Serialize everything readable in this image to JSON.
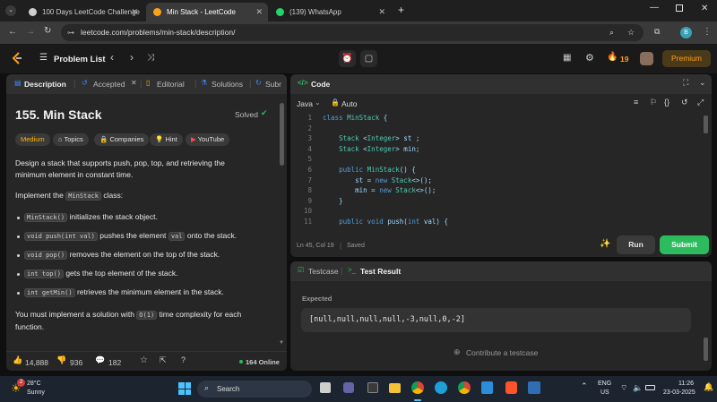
{
  "browser": {
    "tabs": [
      {
        "title": "100 Days LeetCode Challenge",
        "active": false
      },
      {
        "title": "Min Stack - LeetCode",
        "active": true
      },
      {
        "title": "(139) WhatsApp",
        "active": false
      }
    ],
    "new_tab_icon": "plus-icon",
    "url": "leetcode.com/problems/min-stack/description/",
    "profile_initial": "B"
  },
  "header": {
    "problem_list": "Problem List",
    "streak": "19",
    "premium": "Premium"
  },
  "left_panel": {
    "tabs": [
      "Description",
      "Accepted",
      "Editorial",
      "Solutions",
      "Subr"
    ],
    "title": "155. Min Stack",
    "status": "Solved",
    "chips": [
      "Medium",
      "Topics",
      "Companies",
      "Hint",
      "YouTube"
    ],
    "intro_line1": "Design a stack that supports push, pop, top, and retrieving the",
    "intro_line2": "minimum element in constant time.",
    "implement_pre": "Implement the",
    "implement_code": "MinStack",
    "implement_post": "class:",
    "bullets": [
      {
        "code": "MinStack()",
        "text": "initializes the stack object."
      },
      {
        "code": "void push(int val)",
        "text": "pushes the element",
        "code2": "val",
        "text2": "onto the stack."
      },
      {
        "code": "void pop()",
        "text": "removes the element on the top of the stack."
      },
      {
        "code": "int top()",
        "text": "gets the top element of the stack."
      },
      {
        "code": "int getMin()",
        "text": "retrieves the minimum element in the stack."
      }
    ],
    "footer_pre": "You must implement a solution with",
    "footer_code": "O(1)",
    "footer_post": "time complexity for each",
    "footer_line2": "function.",
    "likes": "14,888",
    "dislikes": "936",
    "comments": "182",
    "online": "164 Online"
  },
  "code_panel": {
    "title": "Code",
    "language": "Java",
    "mode": "Auto",
    "lines": [
      {
        "n": "1",
        "t": "class MinStack {"
      },
      {
        "n": "2",
        "t": ""
      },
      {
        "n": "3",
        "t": "    Stack <Integer> st ;"
      },
      {
        "n": "4",
        "t": "    Stack <Integer> min;"
      },
      {
        "n": "5",
        "t": ""
      },
      {
        "n": "6",
        "t": "    public MinStack() {"
      },
      {
        "n": "7",
        "t": "        st = new Stack<>();"
      },
      {
        "n": "8",
        "t": "        min = new Stack<>();"
      },
      {
        "n": "9",
        "t": "    }"
      },
      {
        "n": "10",
        "t": ""
      },
      {
        "n": "11",
        "t": "    public void push(int val) {"
      }
    ],
    "cursor": "Ln 45, Col 19",
    "saved": "Saved",
    "run": "Run",
    "submit": "Submit"
  },
  "result_panel": {
    "tabs": [
      "Testcase",
      "Test Result"
    ],
    "expected_label": "Expected",
    "expected_value": "[null,null,null,null,-3,null,0,-2]",
    "contribute": "Contribute a testcase"
  },
  "taskbar": {
    "weather_temp": "28°C",
    "weather_desc": "Sunny",
    "search": "Search",
    "lang1": "ENG",
    "lang2": "US",
    "time": "11:26",
    "date": "23-03-2025",
    "notif": "2"
  },
  "colors": {
    "accent_orange": "#ffa116",
    "green": "#2cbb5d",
    "blue_link": "#3e88f8",
    "medium_yellow": "#ffb800",
    "premium_bg": "#4a3a1a"
  }
}
